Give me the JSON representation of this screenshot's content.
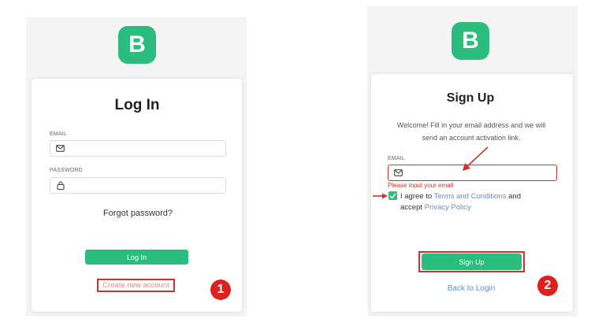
{
  "login": {
    "logo_letter": "B",
    "title": "Log In",
    "email_label": "EMAIL",
    "password_label": "PASSWORD",
    "forgot_link": "Forgot password?",
    "submit_label": "Log In",
    "create_link": "Create new account",
    "step_number": "1"
  },
  "signup": {
    "logo_letter": "B",
    "title": "Sign Up",
    "intro_line1": "Welcome! Fill in your email address and we will",
    "intro_line2": "send an account activation link.",
    "email_label": "EMAIL",
    "email_error": "Please input your email",
    "agree_prefix": "I agree to ",
    "terms_link": "Terms and Conditions",
    "agree_and": " and",
    "accept_prefix": "accept ",
    "privacy_link": "Privacy Policy",
    "agree_checked": true,
    "submit_label": "Sign Up",
    "back_link": "Back to Login",
    "step_number": "2"
  },
  "icons": {
    "email": "envelope-icon",
    "password": "lock-icon",
    "checkbox": "checkmark-icon",
    "annotation": "red-arrow-icon"
  },
  "colors": {
    "brand": "#2bbd7e",
    "link": "#5a8fd6",
    "error": "#d93025",
    "annotation": "#d32f2f"
  }
}
